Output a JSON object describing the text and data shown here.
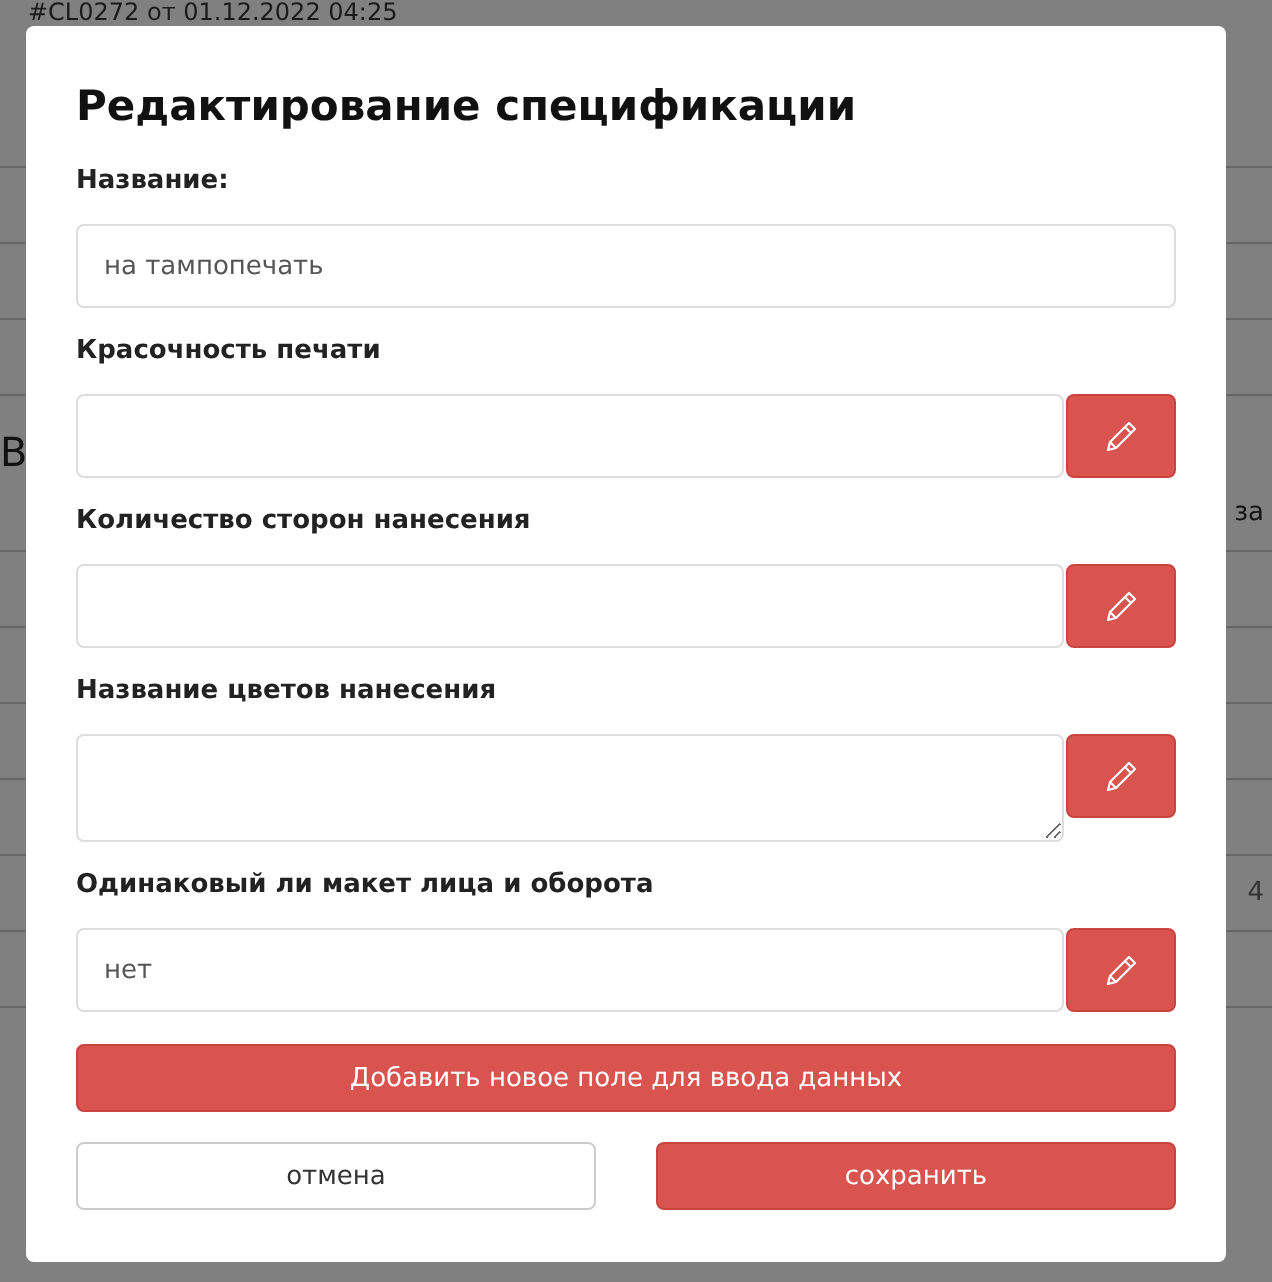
{
  "background": {
    "heading": "#CL0272 от 01.12.2022 04:25",
    "section": "В",
    "column_fragment": "за",
    "cell_fragment": "4"
  },
  "dialog": {
    "title": "Редактирование спецификации",
    "fields": [
      {
        "kind": "input",
        "label": "Название:",
        "placeholder": "на тампопечать",
        "editable": false
      },
      {
        "kind": "input",
        "label": "Красочность печати",
        "editable": true
      },
      {
        "kind": "input",
        "label": "Количество сторон нанесения",
        "editable": true
      },
      {
        "kind": "textarea",
        "label": "Название цветов нанесения",
        "editable": true
      },
      {
        "kind": "input",
        "label": "Одинаковый ли макет лица и оборота",
        "placeholder": "нет",
        "editable": true
      }
    ],
    "add_button": "Добавить новое поле для ввода данных",
    "cancel_button": "отмена",
    "save_button": "сохранить"
  }
}
